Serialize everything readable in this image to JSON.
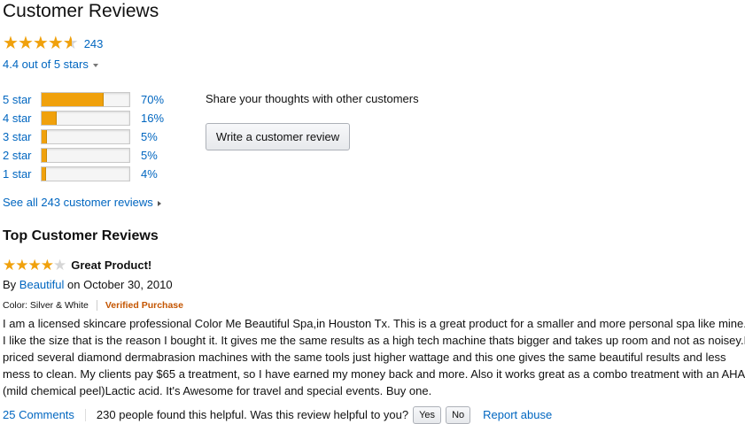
{
  "header": {
    "title": "Customer Reviews"
  },
  "rating": {
    "count_text": "243",
    "average_text": "4.4 out of 5 stars",
    "stars_value": 4.4,
    "star_icon_color": "#f0a10c"
  },
  "histogram": [
    {
      "label": "5 star",
      "percent_text": "70%",
      "fill_percent": 70
    },
    {
      "label": "4 star",
      "percent_text": "16%",
      "fill_percent": 16
    },
    {
      "label": "3 star",
      "percent_text": "5%",
      "fill_percent": 5
    },
    {
      "label": "2 star",
      "percent_text": "5%",
      "fill_percent": 5
    },
    {
      "label": "1 star",
      "percent_text": "4%",
      "fill_percent": 4
    }
  ],
  "share": {
    "prompt": "Share your thoughts with other customers",
    "button_label": "Write a customer review"
  },
  "see_all_text": "See all 243 customer reviews",
  "top_reviews_heading": "Top Customer Reviews",
  "review": {
    "stars_value": 4,
    "title": "Great Product!",
    "by_prefix": "By",
    "author": "Beautiful",
    "date_text": "on October 30, 2010",
    "color_text": "Color: Silver & White",
    "verified_text": "Verified Purchase",
    "body_lines": [
      "I am a licensed skincare professional Color Me Beautiful Spa,in Houston Tx. This is a great product for a smaller and more personal spa like mine.",
      "I like the size that is the reason I bought it. It gives me the same results as a high tech machine thats bigger and takes up room and not as noisey.I",
      "priced several diamond dermabrasion machines with the same tools just higher wattage and this one gives the same beautiful results and less",
      "mess to clean. My clients pay $65 a treatment, so I have earned my money back and more. Also it works great as a combo treatment with an AHA",
      "(mild chemical peel)Lactic acid. It's Awesome for travel and special events. Buy one."
    ],
    "comments_link": "25 Comments",
    "helpful_text": "230 people found this helpful. Was this review helpful to you?",
    "yes_label": "Yes",
    "no_label": "No",
    "report_label": "Report abuse"
  }
}
